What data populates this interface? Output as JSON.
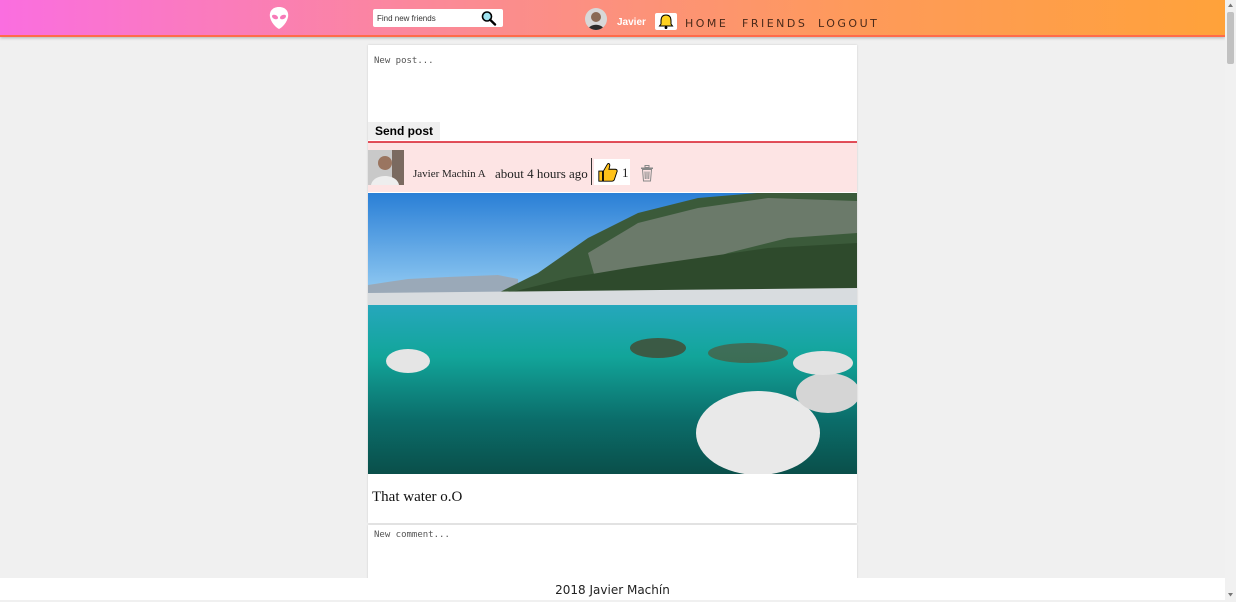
{
  "header": {
    "logo_icon": "alien-head-icon",
    "search": {
      "placeholder": "Find new friends",
      "value": "",
      "button_icon": "magnifier-icon"
    },
    "user": {
      "name": "Javier",
      "avatar_icon": "user-avatar"
    },
    "notifications_icon": "bell-icon",
    "nav": [
      {
        "label": "HOME"
      },
      {
        "label": "FRIENDS"
      },
      {
        "label": "LOGOUT"
      }
    ],
    "gradient": [
      "#fa6ee0",
      "#ffa23a"
    ]
  },
  "composer": {
    "placeholder": "New post...",
    "value": "",
    "send_label": "Send post",
    "accent": "#e8505b"
  },
  "post": {
    "author": "Javier Machín A",
    "time": "about 4 hours ago",
    "likes": "1",
    "like_icon": "thumbs-up-icon",
    "delete_icon": "trash-icon",
    "photo": "lake-with-rocks-photo",
    "text": "That water o.O",
    "header_bg": "#fde4e4"
  },
  "comment": {
    "placeholder": "New comment...",
    "value": ""
  },
  "footer": {
    "text": "2018 Javier Machín"
  }
}
